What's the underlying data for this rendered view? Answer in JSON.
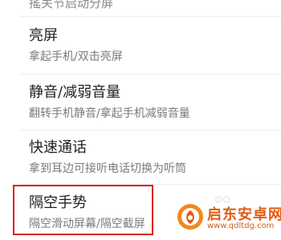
{
  "top_clipped_text": "搖关节启动分屏",
  "settings": [
    {
      "title": "亮屏",
      "subtitle": "拿起手机/双击亮屏"
    },
    {
      "title": "静音/减弱音量",
      "subtitle": "翻转手机静音/拿起手机减弱音量"
    },
    {
      "title": "快速通话",
      "subtitle": "拿到耳边可接听电话切换为听筒"
    },
    {
      "title": "隔空手势",
      "subtitle": "隔空滑动屏幕/隔空截屏"
    }
  ],
  "side_marks": "○○",
  "watermark": {
    "name": "启东安卓网",
    "url": "www.qdltdg.com"
  },
  "colors": {
    "highlight": "#e0201c",
    "watermark": "#e35a12"
  }
}
